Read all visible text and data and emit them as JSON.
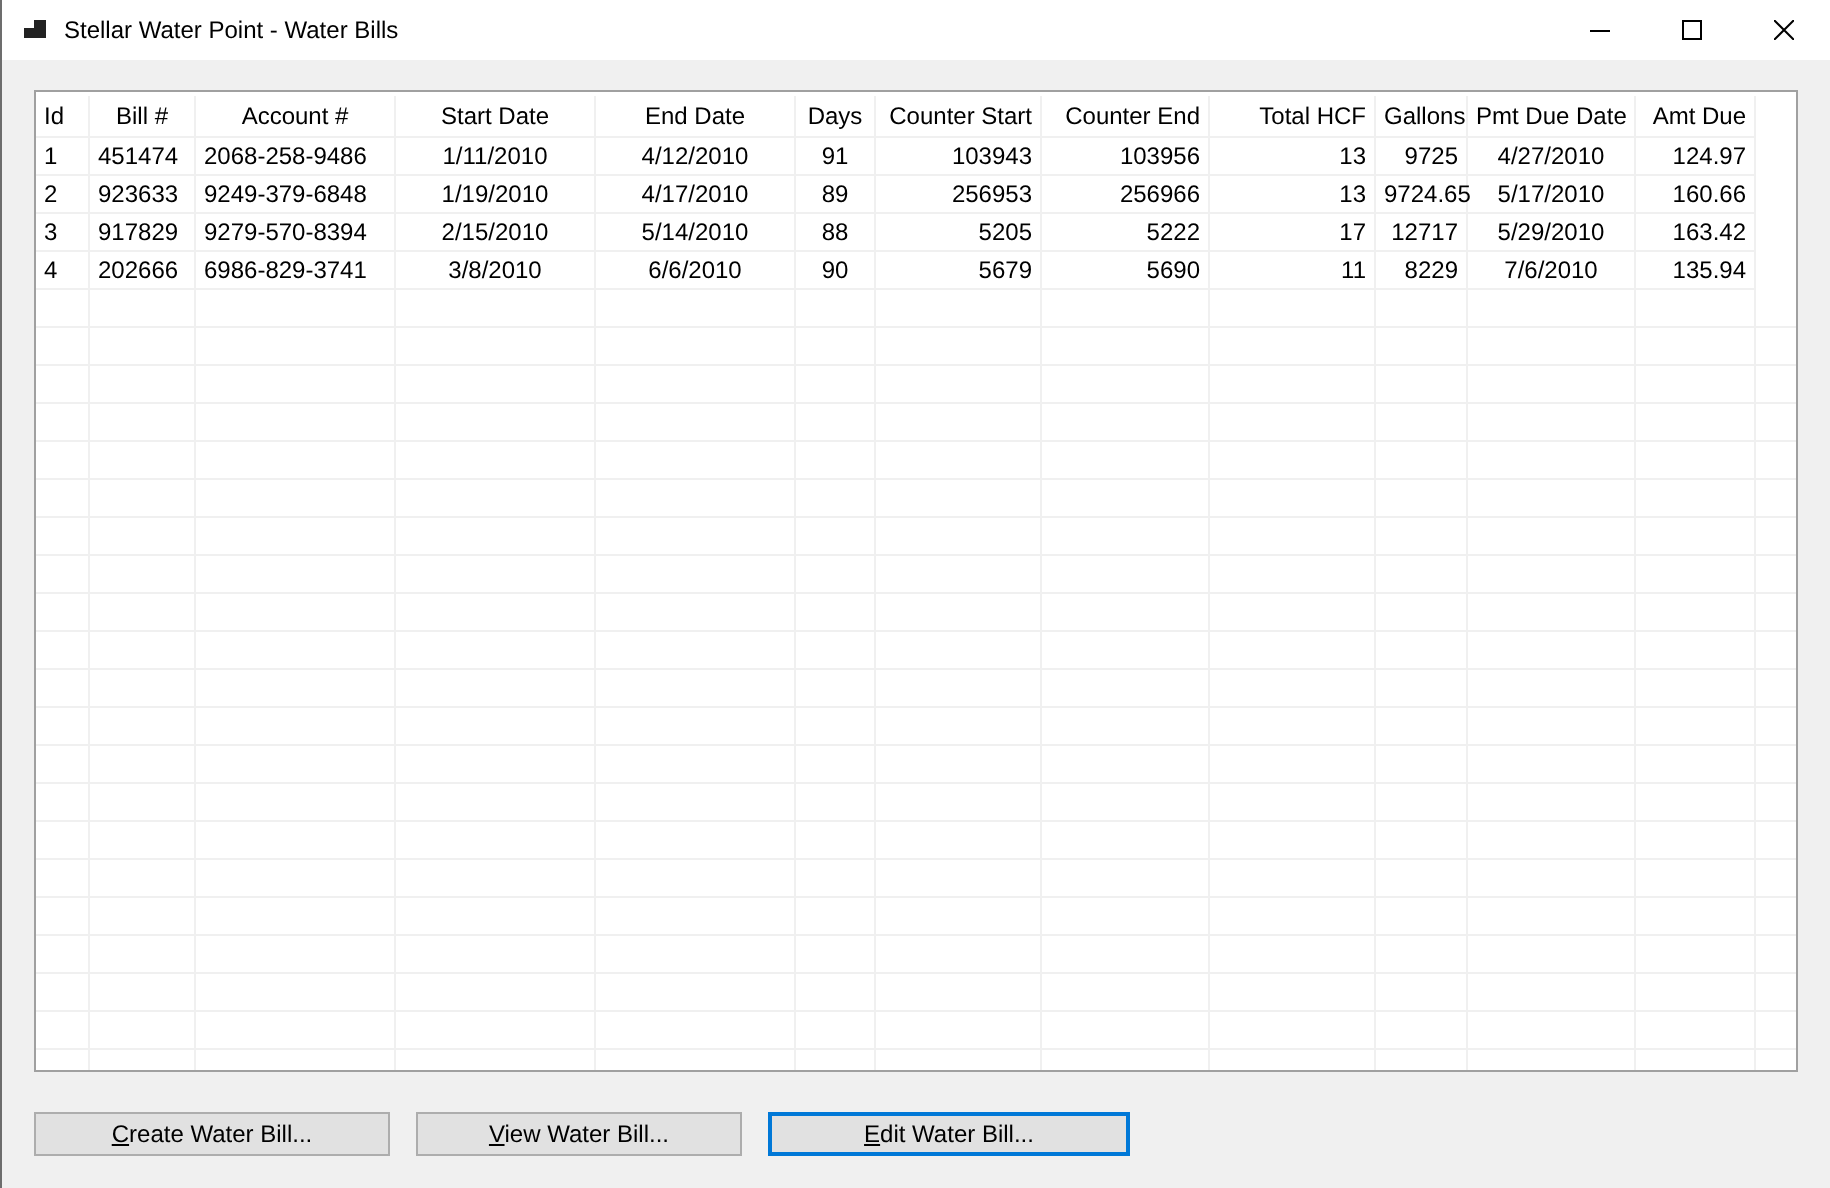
{
  "window": {
    "title": "Stellar Water Point - Water Bills"
  },
  "table": {
    "columns": [
      "Id",
      "Bill #",
      "Account #",
      "Start Date",
      "End Date",
      "Days",
      "Counter Start",
      "Counter End",
      "Total HCF",
      "Gallons",
      "Pmt Due Date",
      "Amt Due"
    ],
    "rows": [
      [
        "1",
        "451474",
        "2068-258-9486",
        "1/11/2010",
        "4/12/2010",
        "91",
        "103943",
        "103956",
        "13",
        "9725",
        "4/27/2010",
        "124.97"
      ],
      [
        "2",
        "923633",
        "9249-379-6848",
        "1/19/2010",
        "4/17/2010",
        "89",
        "256953",
        "256966",
        "13",
        "9724.65",
        "5/17/2010",
        "160.66"
      ],
      [
        "3",
        "917829",
        "9279-570-8394",
        "2/15/2010",
        "5/14/2010",
        "88",
        "5205",
        "5222",
        "17",
        "12717",
        "5/29/2010",
        "163.42"
      ],
      [
        "4",
        "202666",
        "6986-829-3741",
        "3/8/2010",
        "6/6/2010",
        "90",
        "5679",
        "5690",
        "11",
        "8229",
        "7/6/2010",
        "135.94"
      ]
    ]
  },
  "buttons": [
    {
      "label": "Create Water Bill...",
      "focused": false
    },
    {
      "label": "View Water Bill...",
      "focused": false
    },
    {
      "label": "Edit Water Bill...",
      "focused": true
    }
  ]
}
